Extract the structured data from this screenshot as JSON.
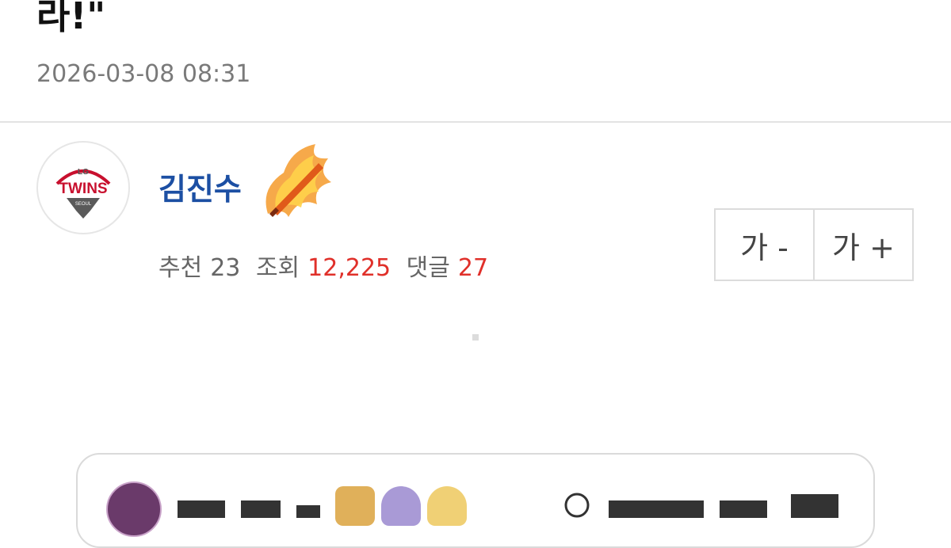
{
  "article": {
    "title_tail": "라!\"",
    "datetime": "2026-03-08 08:31"
  },
  "author": {
    "name": "김진수",
    "avatar_icon": "lg-twins-logo-icon",
    "avatar_logo_top": "LG",
    "avatar_logo_text": "TWINS",
    "avatar_logo_sub": "SEOUL",
    "badge_icon": "flaming-bat-icon"
  },
  "stats": {
    "recommend_label": "추천",
    "recommend_value": "23",
    "views_label": "조회",
    "views_value": "12,225",
    "comments_label": "댓글",
    "comments_value": "27"
  },
  "font_size": {
    "decrease_label": "가 -",
    "increase_label": "가 +"
  },
  "colors": {
    "author_name": "#1c4fa3",
    "highlight_red": "#e0302a",
    "meta_gray": "#7a7a7a"
  }
}
